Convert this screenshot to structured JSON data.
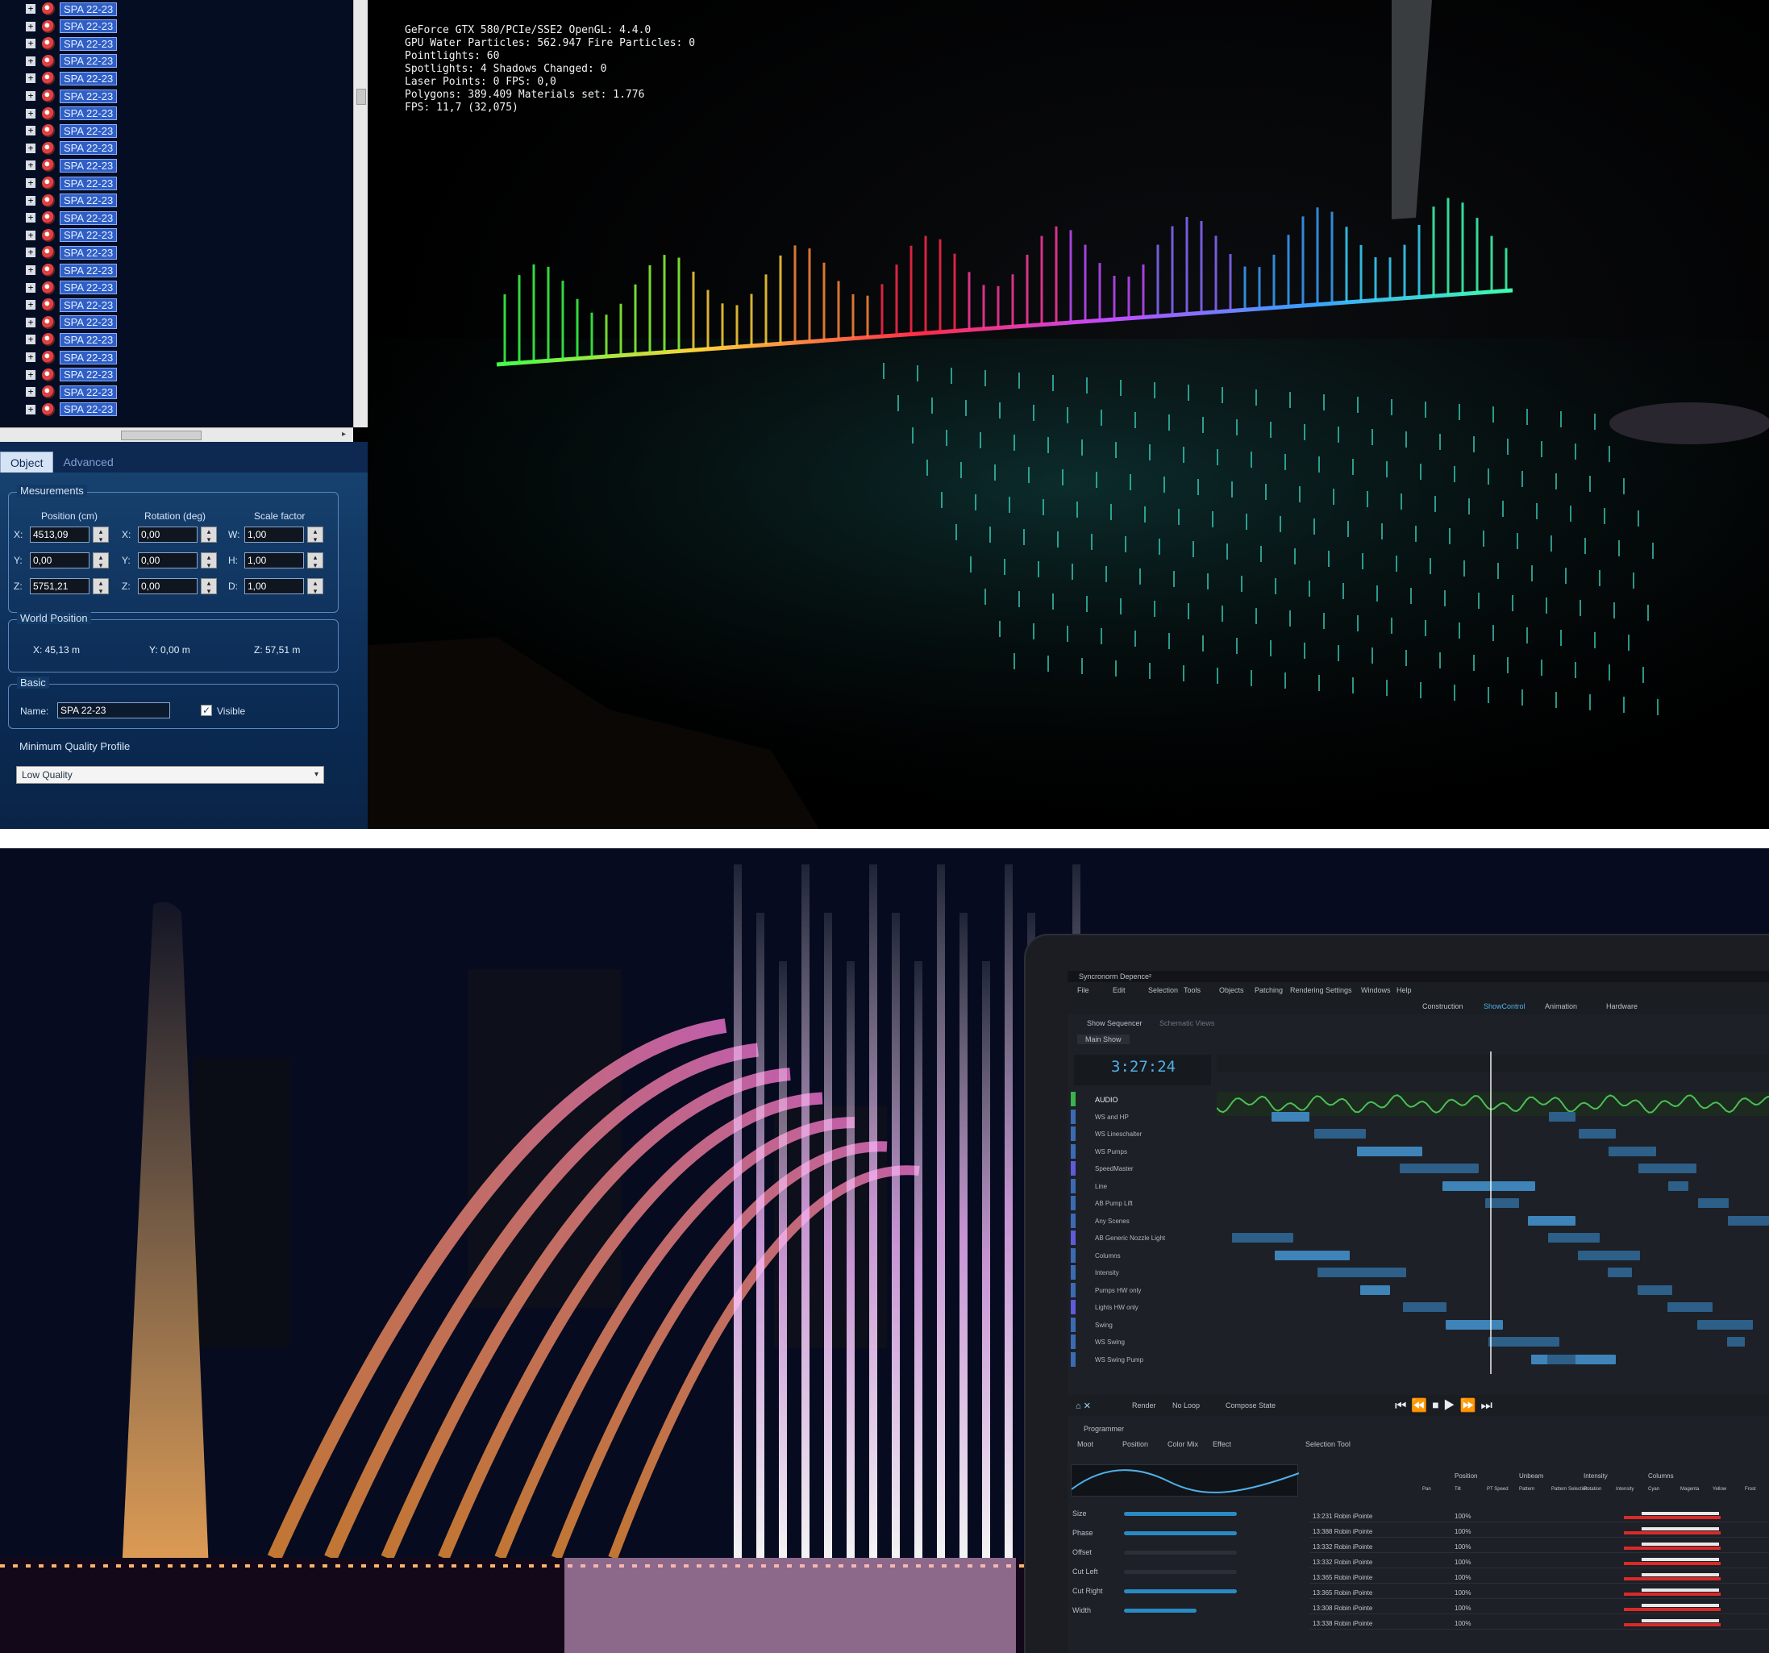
{
  "tree": {
    "items": [
      "SPA 22-23",
      "SPA 22-23",
      "SPA 22-23",
      "SPA 22-23",
      "SPA 22-23",
      "SPA 22-23",
      "SPA 22-23",
      "SPA 22-23",
      "SPA 22-23",
      "SPA 22-23",
      "SPA 22-23",
      "SPA 22-23",
      "SPA 22-23",
      "SPA 22-23",
      "SPA 22-23",
      "SPA 22-23",
      "SPA 22-23",
      "SPA 22-23",
      "SPA 22-23",
      "SPA 22-23",
      "SPA 22-23",
      "SPA 22-23",
      "SPA 22-23",
      "SPA 22-23"
    ],
    "expand_glyph": "+",
    "node_icon": "fountain-node-icon"
  },
  "tabs": {
    "object": "Object",
    "advanced": "Advanced"
  },
  "measurements": {
    "title": "Mesurements",
    "position_header": "Position (cm)",
    "rotation_header": "Rotation (deg)",
    "scale_header": "Scale factor",
    "axes_pos": [
      "X:",
      "Y:",
      "Z:"
    ],
    "axes_rot": [
      "X:",
      "Y:",
      "Z:"
    ],
    "axes_scale": [
      "W:",
      "H:",
      "D:"
    ],
    "position": [
      "4513,09",
      "0,00",
      "5751,21"
    ],
    "rotation": [
      "0,00",
      "0,00",
      "0,00"
    ],
    "scale": [
      "1,00",
      "1,00",
      "1,00"
    ]
  },
  "world_position": {
    "title": "World Position",
    "x": "X: 45,13 m",
    "y": "Y: 0,00 m",
    "z": "Z: 57,51 m"
  },
  "basic": {
    "title": "Basic",
    "name_label": "Name:",
    "name_value": "SPA 22-23",
    "visible_label": "Visible",
    "visible_check": "✓"
  },
  "quality": {
    "title": "Minimum Quality Profile",
    "value": "Low Quality",
    "arrow": "▾"
  },
  "stats": {
    "lines": [
      "GeForce GTX 580/PCIe/SSE2 OpenGL: 4.4.0",
      "GPU Water Particles: 562.947 Fire Particles: 0",
      "Pointlights: 60",
      "Spotlights: 4 Shadows Changed: 0",
      "Laser Points: 0 FPS: 0,0",
      "Polygons: 389.409 Materials set: 1.776",
      "FPS: 11,7 (32,075)"
    ]
  },
  "laptop_app": {
    "title": "Syncronorm Depence²",
    "menu": [
      "File",
      "Edit",
      "Selection",
      "Tools",
      "Objects",
      "Patching",
      "Rendering",
      "Settings",
      "Windows",
      "Help"
    ],
    "modes": [
      "Construction",
      "ShowControl",
      "Animation",
      "Hardware"
    ],
    "subtabs": [
      "Show Sequencer",
      "Schematic Views"
    ],
    "show_tab": "Main Show",
    "timecode": "3:27:24",
    "tracks": [
      "AUDIO",
      "WS and HP",
      "WS Lineschalter",
      "WS Pumps",
      "SpeedMaster",
      "Line",
      "AB Pump Lift",
      "Any Scenes",
      "AB Generic Nozzle Light",
      "Columns",
      "Intensity",
      "Pumps HW only",
      "Lights HW only",
      "Swing",
      "WS Swing",
      "WS Swing Pump"
    ],
    "toolbar": [
      "Render",
      "No Loop",
      "Compose State"
    ],
    "programmer_label": "Programmer",
    "programmer_tabs": [
      "Moot",
      "Position",
      "Color Mix",
      "Effect"
    ],
    "selection_tool": "Selection Tool",
    "effect_params": [
      "Size",
      "Phase",
      "Offset",
      "Cut Left",
      "Cut Right",
      "Width"
    ],
    "fixtures": [
      "13:231 Robin iPointe",
      "13:388 Robin iPointe",
      "13:332 Robin iPointe",
      "13:332 Robin iPointe",
      "13:365 Robin iPointe",
      "13:365 Robin iPointe",
      "13:308 Robin iPointe",
      "13:338 Robin iPointe"
    ],
    "attr_groups": [
      "Position",
      "Unbeam",
      "Intensity",
      "Columns"
    ],
    "attr_headers": [
      "Pan",
      "Tilt",
      "PT Speed",
      "Pattern",
      "Pattern Selection",
      "Rotation",
      "Intensity",
      "Cyan",
      "Magenta",
      "Yellow",
      "Frost"
    ],
    "pct_values": [
      "100%",
      "100%",
      "100%",
      "100%",
      "100%",
      "100%",
      "100%",
      "100%"
    ]
  },
  "colors": {
    "tree_bg": "#050d22",
    "tree_label": "#2f5fc6",
    "panel_blue": "#0b2c55",
    "accent_cyan": "#2a8bc4",
    "red": "#d92a2a"
  }
}
